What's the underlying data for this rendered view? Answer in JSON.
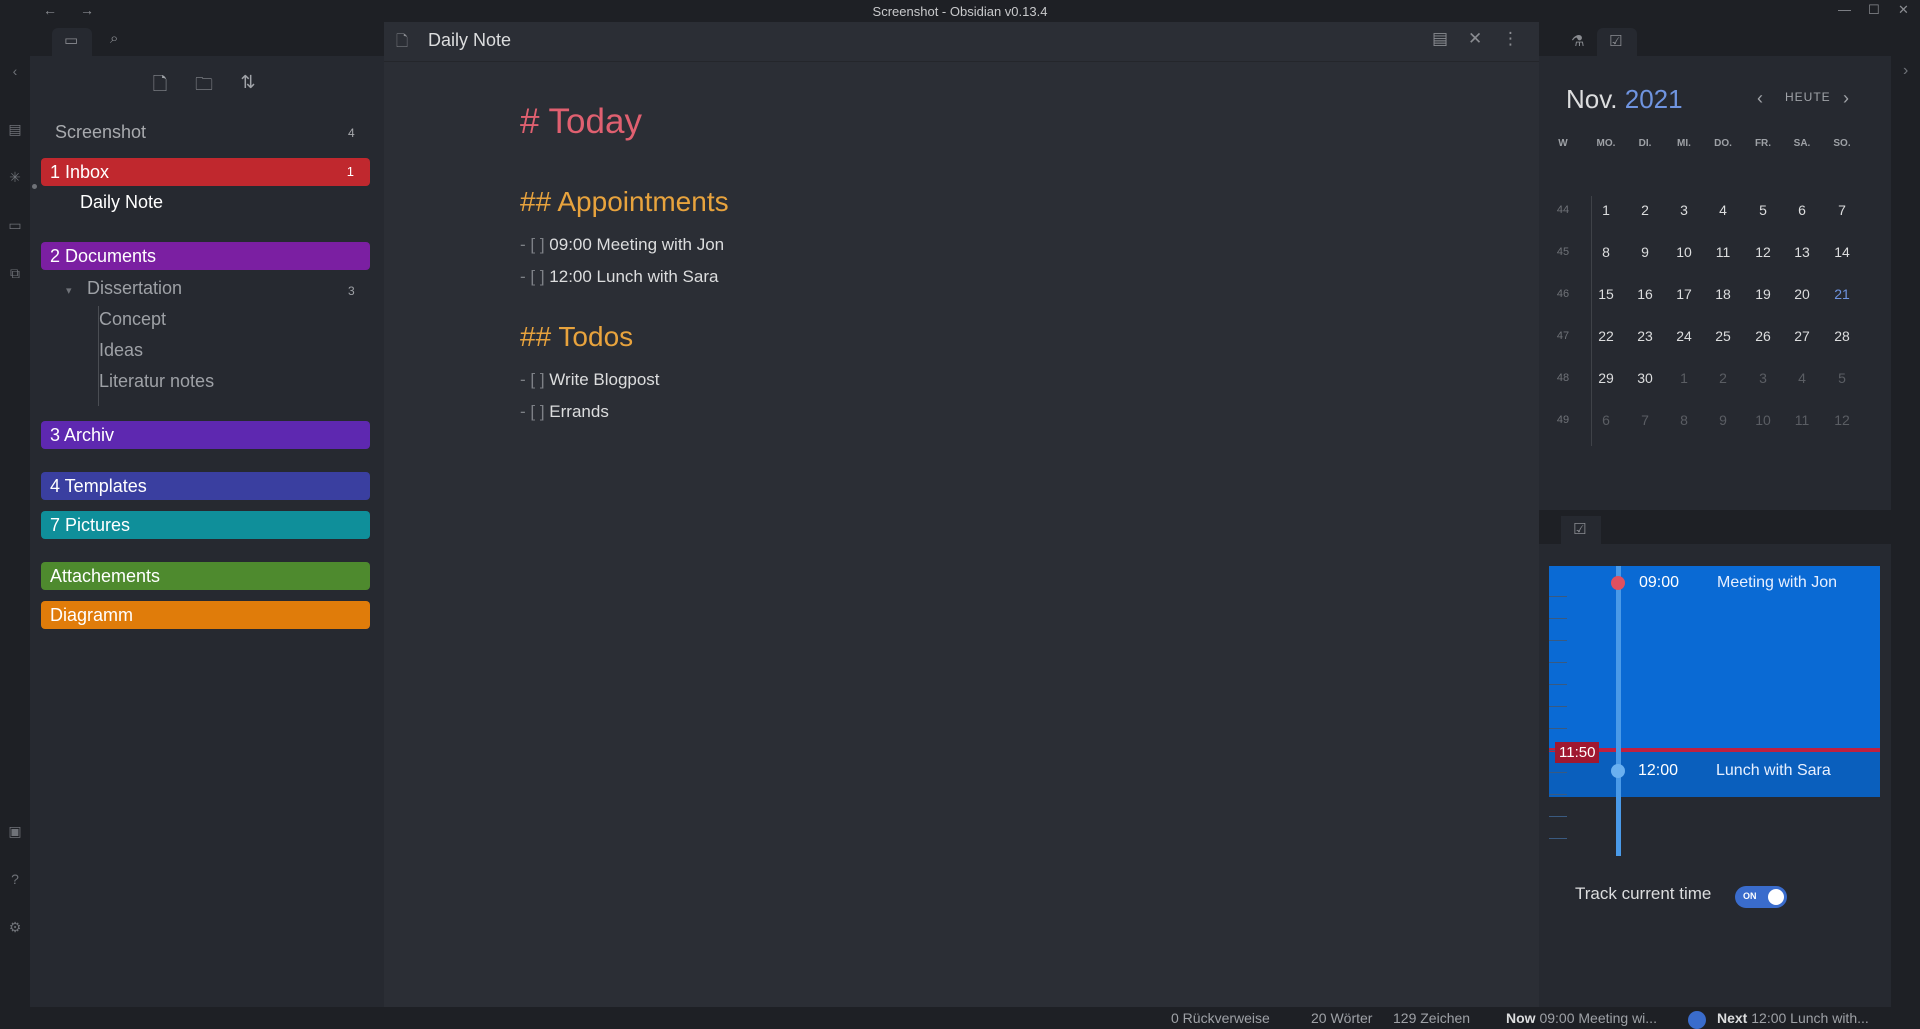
{
  "window": {
    "title": "Screenshot - Obsidian v0.13.4",
    "back": "←",
    "forward": "→",
    "minimize": "—",
    "maximize": "☐",
    "close": "✕"
  },
  "explorer": {
    "vault_name": "Screenshot",
    "vault_count": "4",
    "folders": [
      {
        "label": "1 Inbox",
        "count": "1",
        "color": "#c0282e"
      },
      {
        "label": "2 Documents",
        "color": "#7b1fa2"
      },
      {
        "label": "3 Archiv",
        "color": "#5e28b0"
      },
      {
        "label": "4 Templates",
        "color": "#3a3fa0"
      },
      {
        "label": "7 Pictures",
        "color": "#0f8f9a"
      },
      {
        "label": "Attachements",
        "color": "#4e8a2e"
      },
      {
        "label": "Diagramm",
        "color": "#e07c0a"
      }
    ],
    "inbox_file": "Daily Note",
    "subfolder": {
      "label": "Dissertation",
      "count": "3",
      "caret": "▾"
    },
    "sub_files": [
      "Concept",
      "Ideas",
      "Literatur notes"
    ]
  },
  "editor": {
    "tab_title": "Daily Note",
    "h1": "# Today",
    "h2_appointments": "## Appointments",
    "appointments": [
      {
        "marker": "- [ ]",
        "text": "09:00 Meeting with Jon"
      },
      {
        "marker": "- [ ]",
        "text": "12:00 Lunch with Sara"
      }
    ],
    "h2_todos": "## Todos",
    "todos": [
      {
        "marker": "- [ ]",
        "text": "Write Blogpost"
      },
      {
        "marker": "- [ ]",
        "text": "Errands"
      }
    ]
  },
  "calendar": {
    "month": "Nov.",
    "year": "2021",
    "today_label": "HEUTE",
    "prev": "‹",
    "next": "›",
    "col_headers": [
      "W",
      "MO.",
      "DI.",
      "MI.",
      "DO.",
      "FR.",
      "SA.",
      "SO."
    ],
    "weeks": [
      {
        "wk": "44",
        "days": [
          "1",
          "2",
          "3",
          "4",
          "5",
          "6",
          "7"
        ]
      },
      {
        "wk": "45",
        "days": [
          "8",
          "9",
          "10",
          "11",
          "12",
          "13",
          "14"
        ]
      },
      {
        "wk": "46",
        "days": [
          "15",
          "16",
          "17",
          "18",
          "19",
          "20",
          "21"
        ]
      },
      {
        "wk": "47",
        "days": [
          "22",
          "23",
          "24",
          "25",
          "26",
          "27",
          "28"
        ]
      },
      {
        "wk": "48",
        "days": [
          "29",
          "30",
          "1",
          "2",
          "3",
          "4",
          "5"
        ]
      },
      {
        "wk": "49",
        "days": [
          "6",
          "7",
          "8",
          "9",
          "10",
          "11",
          "12"
        ]
      }
    ],
    "current_day": "21"
  },
  "day_planner": {
    "events": [
      {
        "time": "09:00",
        "title": "Meeting with Jon",
        "dot_color": "#e05060"
      },
      {
        "time": "12:00",
        "title": "Lunch with Sara",
        "dot_color": "#6ab0f0"
      }
    ],
    "now_label": "11:50",
    "track_label": "Track current time",
    "toggle_label": "ON"
  },
  "statusbar": {
    "backlinks": "0 Rückverweise",
    "words": "20 Wörter",
    "chars": "129 Zeichen",
    "now_label": "Now",
    "now_text": "09:00 Meeting wi...",
    "next_label": "Next",
    "next_text": "12:00 Lunch with..."
  }
}
